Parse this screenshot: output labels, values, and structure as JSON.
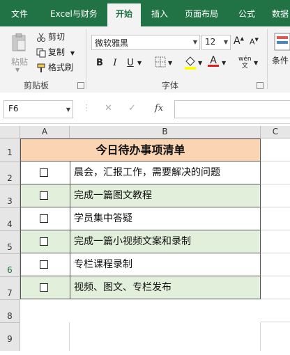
{
  "tabs": [
    "文件",
    "Excel与财务",
    "开始",
    "插入",
    "页面布局",
    "公式",
    "数据"
  ],
  "active_tab": "开始",
  "clipboard": {
    "paste_label": "粘贴",
    "cut_label": "剪切",
    "copy_label": "复制",
    "format_painter_label": "格式刷",
    "group_label": "剪贴板"
  },
  "font": {
    "font_name": "微软雅黑",
    "font_size": "12",
    "grow": "A",
    "shrink": "A",
    "bold": "B",
    "italic": "I",
    "underline": "U",
    "font_color_glyph": "A",
    "phonetic": "wén",
    "group_label": "字体"
  },
  "styles": {
    "conditional_label": "条件"
  },
  "formula_bar": {
    "name_box": "F6",
    "fx": "fx",
    "formula": ""
  },
  "columns": [
    "A",
    "B",
    "C"
  ],
  "rows": [
    "1",
    "2",
    "3",
    "4",
    "5",
    "6",
    "7",
    "8",
    "9"
  ],
  "sheet": {
    "title": "今日待办事项清单",
    "checkbox_glyph": "□",
    "tasks": [
      "晨会，汇报工作，需要解决的问题",
      "完成一篇图文教程",
      "学员集中答疑",
      "完成一篇小视频文案和录制",
      "专栏课程录制",
      "视频、图文、专栏发布"
    ]
  },
  "colors": {
    "ribbon_green": "#217346",
    "title_fill": "#fbd4b4",
    "alt_row_fill": "#e2efda",
    "font_color_red": "#e02020"
  }
}
